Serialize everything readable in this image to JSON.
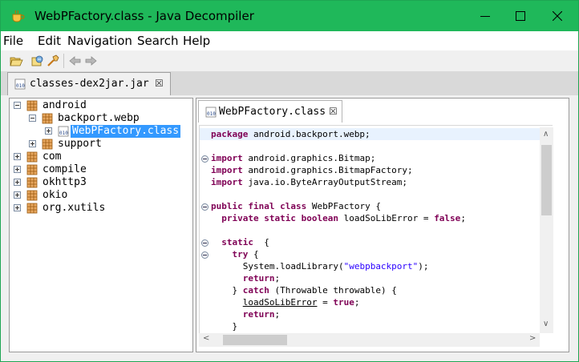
{
  "window": {
    "title": "WebPFactory.class - Java Decompiler",
    "controls": [
      "minimize",
      "maximize",
      "close"
    ]
  },
  "menu": [
    "File",
    "Edit",
    "Navigation",
    "Search",
    "Help"
  ],
  "toolbar": {
    "icons": [
      "open-file-icon",
      "open-type-icon",
      "search-icon",
      "back-arrow-icon",
      "forward-arrow-icon"
    ]
  },
  "main_tab": {
    "label": "classes-dex2jar.jar",
    "close": "☒"
  },
  "tree": {
    "nodes": [
      {
        "label": "android",
        "expanded": true
      },
      {
        "label": "backport.webp",
        "expanded": true
      },
      {
        "label": "WebPFactory.class",
        "selected": true
      },
      {
        "label": "support",
        "expanded": false
      },
      {
        "label": "com",
        "expanded": false
      },
      {
        "label": "compile",
        "expanded": false
      },
      {
        "label": "okhttp3",
        "expanded": false
      },
      {
        "label": "okio",
        "expanded": false
      },
      {
        "label": "org.xutils",
        "expanded": false
      }
    ]
  },
  "editor": {
    "tab_label": "WebPFactory.class",
    "tab_close": "☒",
    "code": [
      {
        "t": "package android.backport.webp;"
      },
      {
        "t": ""
      },
      {
        "t": "import android.graphics.Bitmap;"
      },
      {
        "t": "import android.graphics.BitmapFactory;"
      },
      {
        "t": "import java.io.ByteArrayOutputStream;"
      },
      {
        "t": ""
      },
      {
        "t": "public final class WebPFactory {"
      },
      {
        "t": "  private static boolean loadSoLibError = false;"
      },
      {
        "t": ""
      },
      {
        "t": "  static  {"
      },
      {
        "t": "    try {"
      },
      {
        "t": "      System.loadLibrary(\"webpbackport\");"
      },
      {
        "t": "      return;"
      },
      {
        "t": "    } catch (Throwable throwable) {"
      },
      {
        "t": "      loadSoLibError = true;"
      },
      {
        "t": "      return;"
      },
      {
        "t": "    }"
      }
    ]
  },
  "colors": {
    "titlebar": "#1fb85a",
    "selection": "#3399ff",
    "keyword": "#7f0055",
    "string": "#2a00ff",
    "current_line": "#e8f2fe"
  }
}
